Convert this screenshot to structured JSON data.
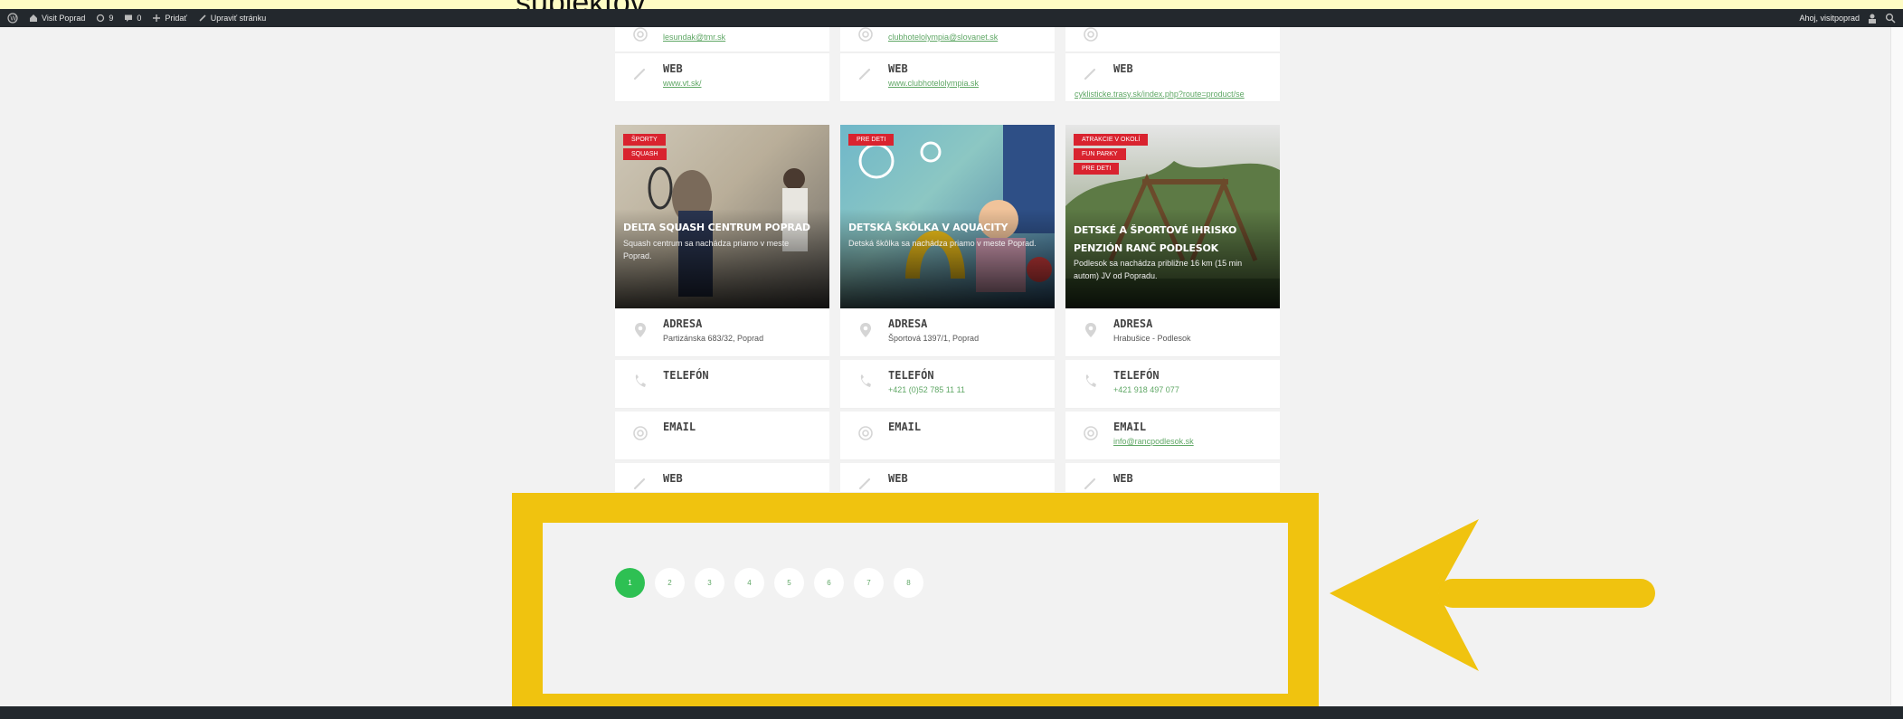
{
  "caption": "subjektov",
  "adminbar": {
    "site": "Visit Poprad",
    "updates": "9",
    "comments": "0",
    "add": "Pridať",
    "edit": "Upraviť stránku",
    "greeting": "Ahoj, visitpoprad"
  },
  "top_rows": [
    {
      "email": "lesundak@tmr.sk",
      "web_label": "WEB",
      "web": "www.vt.sk/"
    },
    {
      "email": "clubhotelolympia@slovanet.sk",
      "web_label": "WEB",
      "web": "www.clubhotelolympia.sk"
    },
    {
      "email": "",
      "web_label": "WEB",
      "web": "cyklisticke.trasy.sk/index.php?route=product/se"
    }
  ],
  "cards": [
    {
      "tags": [
        "ŠPORTY",
        "SQUASH"
      ],
      "title": "DELTA SQUASH CENTRUM POPRAD",
      "desc": "Squash centrum sa nachádza priamo v meste Poprad.",
      "adresa_label": "ADRESA",
      "adresa": "Partizánska 683/32, Poprad",
      "telefon_label": "TELEFÓN",
      "telefon": "",
      "email_label": "EMAIL",
      "email": "",
      "web_label": "WEB"
    },
    {
      "tags": [
        "PRE DETI"
      ],
      "title": "DETSKÁ ŠKÔLKA V AQUACITY",
      "desc": "Detská škôlka sa nachádza priamo v meste Poprad.",
      "adresa_label": "ADRESA",
      "adresa": "Športová 1397/1, Poprad",
      "telefon_label": "TELEFÓN",
      "telefon": "+421 (0)52 785 11 11",
      "email_label": "EMAIL",
      "email": "",
      "web_label": "WEB"
    },
    {
      "tags": [
        "ATRAKCIE V OKOLÍ",
        "FUN PARKY",
        "PRE DETI"
      ],
      "title": "DETSKÉ A ŠPORTOVÉ IHRISKO PENZIÓN RANČ PODLESOK",
      "desc": "Podlesok sa nachádza približne 16 km (15 min autom) JV od Popradu.",
      "adresa_label": "ADRESA",
      "adresa": "Hrabušice - Podlesok",
      "telefon_label": "TELEFÓN",
      "telefon": "+421 918 497 077",
      "email_label": "EMAIL",
      "email": "info@rancpodlesok.sk",
      "web_label": "WEB"
    }
  ],
  "pagination": [
    "1",
    "2",
    "3",
    "4",
    "5",
    "6",
    "7",
    "8"
  ],
  "colors": {
    "accent": "#2ec053",
    "tag": "#d9232f",
    "highlight": "#f0c30f"
  }
}
